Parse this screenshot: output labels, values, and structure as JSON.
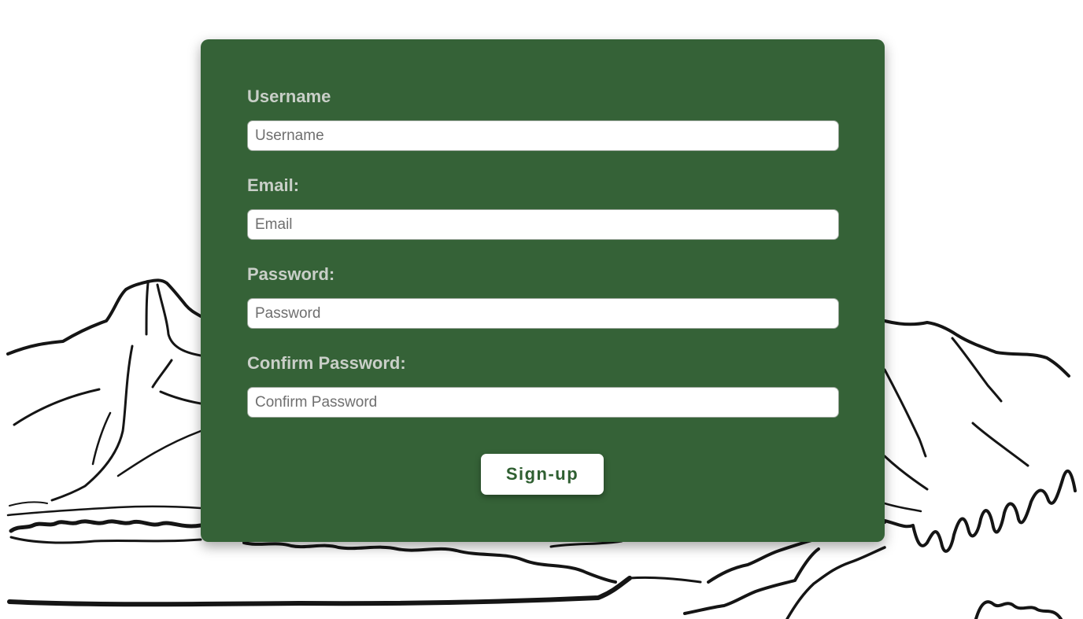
{
  "form": {
    "fields": [
      {
        "label": "Username",
        "placeholder": "Username"
      },
      {
        "label": "Email:",
        "placeholder": "Email"
      },
      {
        "label": "Password:",
        "placeholder": "Password"
      },
      {
        "label": "Confirm Password:",
        "placeholder": "Confirm Password"
      }
    ],
    "submit_label": "Sign-up"
  },
  "colors": {
    "card_background": "#356237",
    "label_text": "#c9cfc8",
    "button_text": "#2f5f31"
  }
}
